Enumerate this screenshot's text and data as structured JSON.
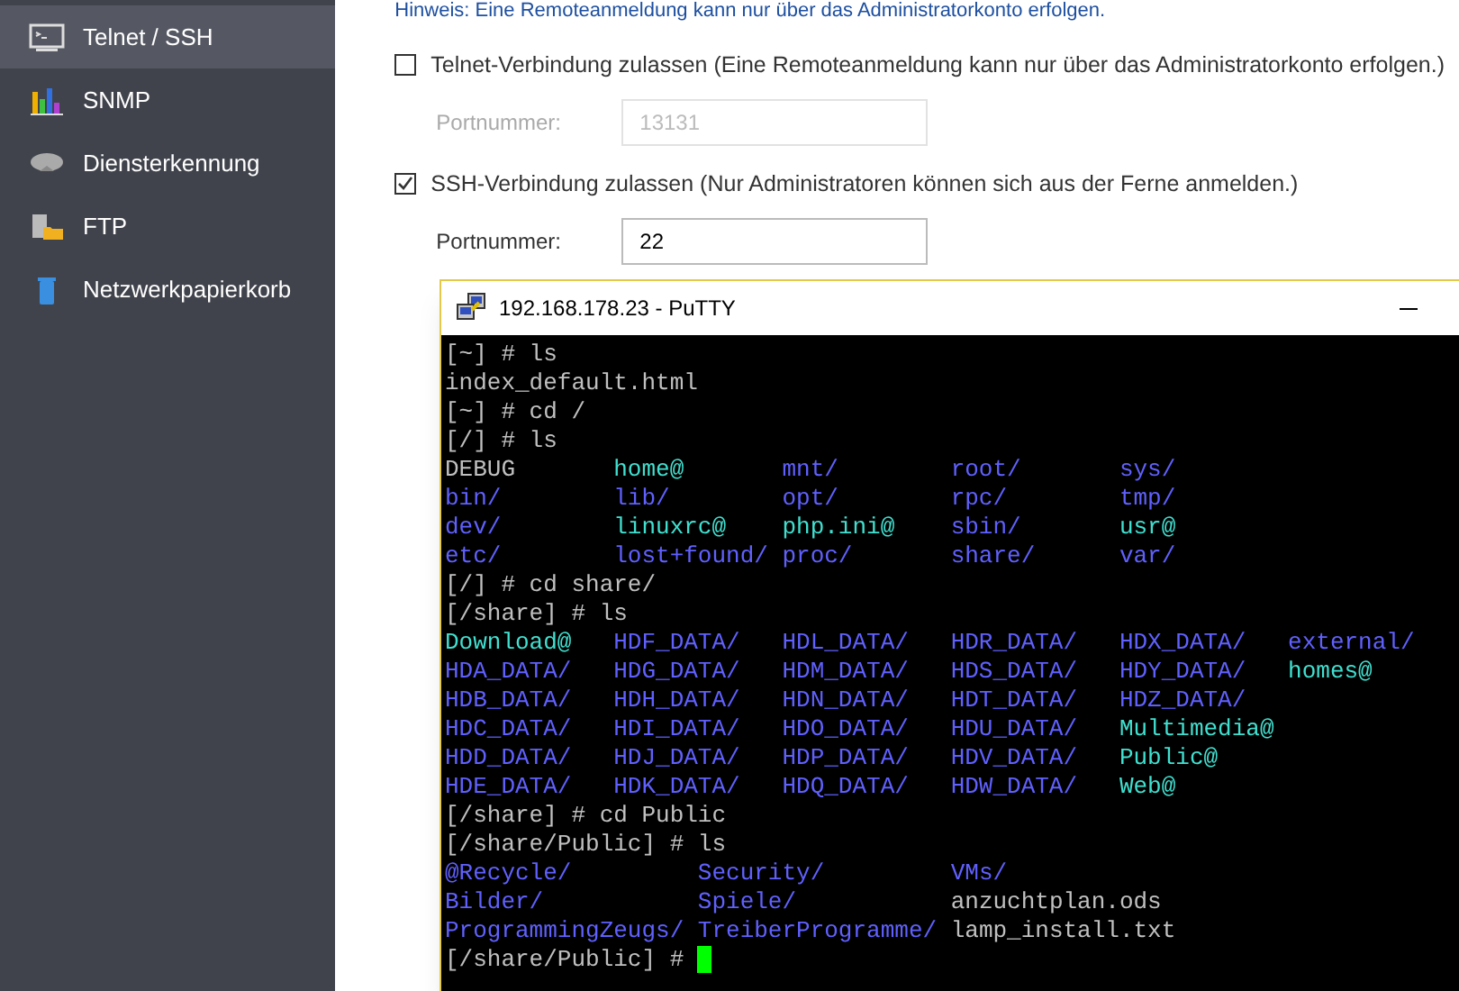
{
  "sidebar": {
    "items": [
      {
        "label": "Telnet / SSH",
        "selected": true
      },
      {
        "label": "SNMP",
        "selected": false
      },
      {
        "label": "Diensterkennung",
        "selected": false
      },
      {
        "label": "FTP",
        "selected": false
      },
      {
        "label": "Netzwerkpapierkorb",
        "selected": false
      }
    ]
  },
  "settings": {
    "hint": "Hinweis: Eine Remoteanmeldung kann nur über das Administratorkonto erfolgen.",
    "options": [
      {
        "label": "Telnet-Verbindung zulassen (Eine Remoteanmeldung kann nur über das Administratorkonto erfolgen.)",
        "checked": false,
        "port_label": "Portnummer:",
        "port": "13131",
        "disabled": true
      },
      {
        "label": "SSH-Verbindung zulassen (Nur Administratoren können sich aus der Ferne anmelden.)",
        "checked": true,
        "port_label": "Portnummer:",
        "port": "22",
        "disabled": false
      }
    ]
  },
  "terminal": {
    "title": "192.168.178.23 - PuTTY",
    "lines": [
      {
        "kind": "text",
        "text": "[~] # ls"
      },
      {
        "kind": "text",
        "text": "index_default.html"
      },
      {
        "kind": "text",
        "text": "[~] # cd /"
      },
      {
        "kind": "text",
        "text": "[/] # ls"
      },
      {
        "kind": "listing",
        "rows": [
          [
            {
              "text": "DEBUG",
              "kind": "file"
            },
            {
              "text": "home@",
              "kind": "link"
            },
            {
              "text": "mnt/",
              "kind": "dir"
            },
            {
              "text": "root/",
              "kind": "dir"
            },
            {
              "text": "sys/",
              "kind": "dir"
            }
          ],
          [
            {
              "text": "bin/",
              "kind": "dir"
            },
            {
              "text": "lib/",
              "kind": "dir"
            },
            {
              "text": "opt/",
              "kind": "dir"
            },
            {
              "text": "rpc/",
              "kind": "dir"
            },
            {
              "text": "tmp/",
              "kind": "dir"
            }
          ],
          [
            {
              "text": "dev/",
              "kind": "dir"
            },
            {
              "text": "linuxrc@",
              "kind": "link"
            },
            {
              "text": "php.ini@",
              "kind": "link"
            },
            {
              "text": "sbin/",
              "kind": "dir"
            },
            {
              "text": "usr@",
              "kind": "link"
            }
          ],
          [
            {
              "text": "etc/",
              "kind": "dir"
            },
            {
              "text": "lost+found/",
              "kind": "dir"
            },
            {
              "text": "proc/",
              "kind": "dir"
            },
            {
              "text": "share/",
              "kind": "dir"
            },
            {
              "text": "var/",
              "kind": "dir"
            }
          ]
        ]
      },
      {
        "kind": "text",
        "text": "[/] # cd share/"
      },
      {
        "kind": "text",
        "text": "[/share] # ls"
      },
      {
        "kind": "listing",
        "rows": [
          [
            {
              "text": "Download@",
              "kind": "link"
            },
            {
              "text": "HDF_DATA/",
              "kind": "dir"
            },
            {
              "text": "HDL_DATA/",
              "kind": "dir"
            },
            {
              "text": "HDR_DATA/",
              "kind": "dir"
            },
            {
              "text": "HDX_DATA/",
              "kind": "dir"
            },
            {
              "text": "external/",
              "kind": "dir"
            }
          ],
          [
            {
              "text": "HDA_DATA/",
              "kind": "dir"
            },
            {
              "text": "HDG_DATA/",
              "kind": "dir"
            },
            {
              "text": "HDM_DATA/",
              "kind": "dir"
            },
            {
              "text": "HDS_DATA/",
              "kind": "dir"
            },
            {
              "text": "HDY_DATA/",
              "kind": "dir"
            },
            {
              "text": "homes@",
              "kind": "link"
            }
          ],
          [
            {
              "text": "HDB_DATA/",
              "kind": "dir"
            },
            {
              "text": "HDH_DATA/",
              "kind": "dir"
            },
            {
              "text": "HDN_DATA/",
              "kind": "dir"
            },
            {
              "text": "HDT_DATA/",
              "kind": "dir"
            },
            {
              "text": "HDZ_DATA/",
              "kind": "dir"
            }
          ],
          [
            {
              "text": "HDC_DATA/",
              "kind": "dir"
            },
            {
              "text": "HDI_DATA/",
              "kind": "dir"
            },
            {
              "text": "HDO_DATA/",
              "kind": "dir"
            },
            {
              "text": "HDU_DATA/",
              "kind": "dir"
            },
            {
              "text": "Multimedia@",
              "kind": "link"
            }
          ],
          [
            {
              "text": "HDD_DATA/",
              "kind": "dir"
            },
            {
              "text": "HDJ_DATA/",
              "kind": "dir"
            },
            {
              "text": "HDP_DATA/",
              "kind": "dir"
            },
            {
              "text": "HDV_DATA/",
              "kind": "dir"
            },
            {
              "text": "Public@",
              "kind": "link"
            }
          ],
          [
            {
              "text": "HDE_DATA/",
              "kind": "dir"
            },
            {
              "text": "HDK_DATA/",
              "kind": "dir"
            },
            {
              "text": "HDQ_DATA/",
              "kind": "dir"
            },
            {
              "text": "HDW_DATA/",
              "kind": "dir"
            },
            {
              "text": "Web@",
              "kind": "link"
            }
          ]
        ]
      },
      {
        "kind": "text",
        "text": "[/share] # cd Public"
      },
      {
        "kind": "text",
        "text": "[/share/Public] # ls"
      },
      {
        "kind": "listing",
        "rows": [
          [
            {
              "text": "@Recycle/",
              "kind": "dir"
            },
            {
              "text": "Security/",
              "kind": "dir"
            },
            {
              "text": "VMs/",
              "kind": "dir"
            }
          ],
          [
            {
              "text": "Bilder/",
              "kind": "dir"
            },
            {
              "text": "Spiele/",
              "kind": "dir"
            },
            {
              "text": "anzuchtplan.ods",
              "kind": "file"
            }
          ],
          [
            {
              "text": "ProgrammingZeugs/",
              "kind": "dir"
            },
            {
              "text": "TreiberProgramme/",
              "kind": "dir"
            },
            {
              "text": "lamp_install.txt",
              "kind": "file"
            }
          ]
        ]
      },
      {
        "kind": "prompt",
        "text": "[/share/Public] # "
      }
    ]
  }
}
